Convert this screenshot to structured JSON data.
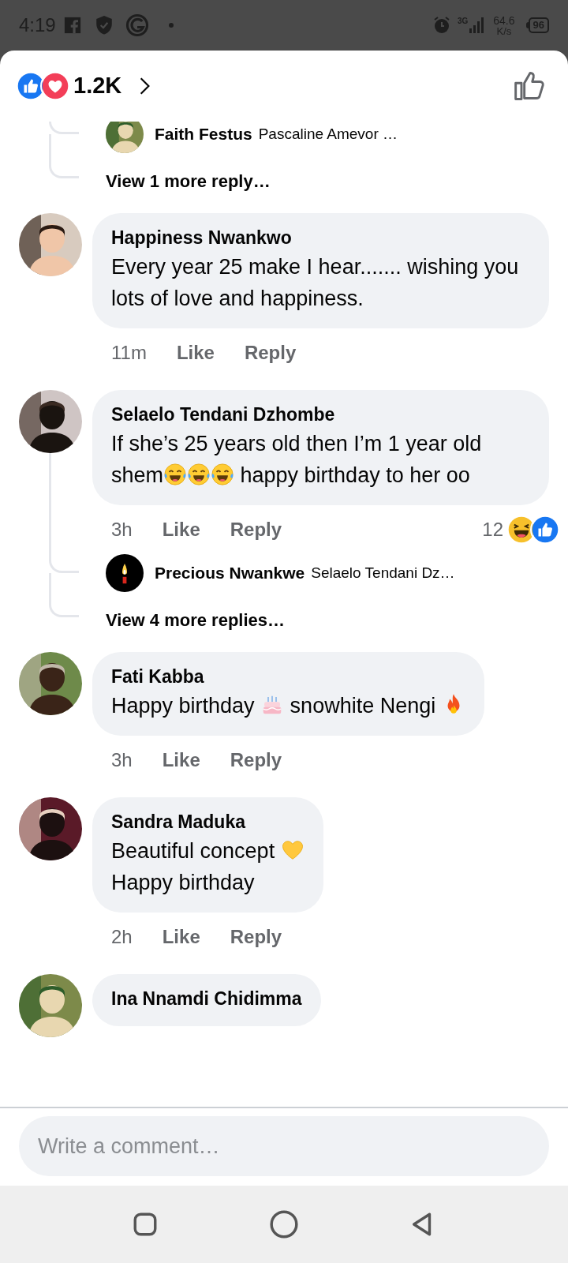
{
  "status_bar": {
    "time": "4:19",
    "network": "3G",
    "speed": "64.6",
    "speed_unit": "K/s",
    "battery": "96"
  },
  "reactions": {
    "icons": [
      {
        "kind": "like"
      },
      {
        "kind": "love"
      }
    ],
    "count": "1.2K"
  },
  "top_thread": {
    "replies": [
      {
        "avatar": {
          "kind": "picture"
        },
        "author": "Faith Festus",
        "preview": "Pascaline Amevor …"
      }
    ],
    "more_replies": "View 1 more reply…"
  },
  "comments": [
    {
      "avatar": {
        "kind": "picture"
      },
      "author": "Happiness Nwankwo",
      "body": [
        {
          "kind": "text",
          "text": "Every year 25 make I hear....... wishing you lots of love and happiness."
        }
      ],
      "time": "11m",
      "actions": [
        "Like",
        "Reply"
      ]
    },
    {
      "avatar": {
        "kind": "picture"
      },
      "author": "Selaelo Tendani Dzhombe",
      "body": [
        {
          "kind": "text",
          "text": "If she’s 25 years old then I’m 1 year old shem"
        },
        {
          "kind": "joy"
        },
        {
          "kind": "joy"
        },
        {
          "kind": "joy"
        },
        {
          "kind": "text",
          "text": " happy birthday to her oo"
        }
      ],
      "time": "3h",
      "actions": [
        "Like",
        "Reply"
      ],
      "reactions": {
        "count": "12",
        "icons": [
          {
            "kind": "haha"
          },
          {
            "kind": "like"
          }
        ]
      },
      "replies": [
        {
          "avatar": {
            "kind": "picture"
          },
          "author": "Precious Nwankwe",
          "preview": "Selaelo Tendani Dz…"
        }
      ],
      "more_replies": "View 4 more replies…"
    },
    {
      "avatar": {
        "kind": "picture"
      },
      "author": "Fati Kabba",
      "body": [
        {
          "kind": "text",
          "text": "Happy birthday "
        },
        {
          "kind": "cake"
        },
        {
          "kind": "text",
          "text": " snowhite Nengi "
        },
        {
          "kind": "fire"
        }
      ],
      "time": "3h",
      "actions": [
        "Like",
        "Reply"
      ]
    },
    {
      "avatar": {
        "kind": "picture"
      },
      "author": "Sandra Maduka",
      "body": [
        {
          "kind": "text",
          "text": "Beautiful concept "
        },
        {
          "kind": "heart"
        },
        {
          "kind": "text",
          "text": "\nHappy birthday"
        }
      ],
      "time": "2h",
      "actions": [
        "Like",
        "Reply"
      ]
    },
    {
      "avatar": {
        "kind": "picture"
      },
      "author": "Ina Nnamdi Chidimma"
    }
  ],
  "composer": {
    "placeholder": "Write a comment…"
  }
}
